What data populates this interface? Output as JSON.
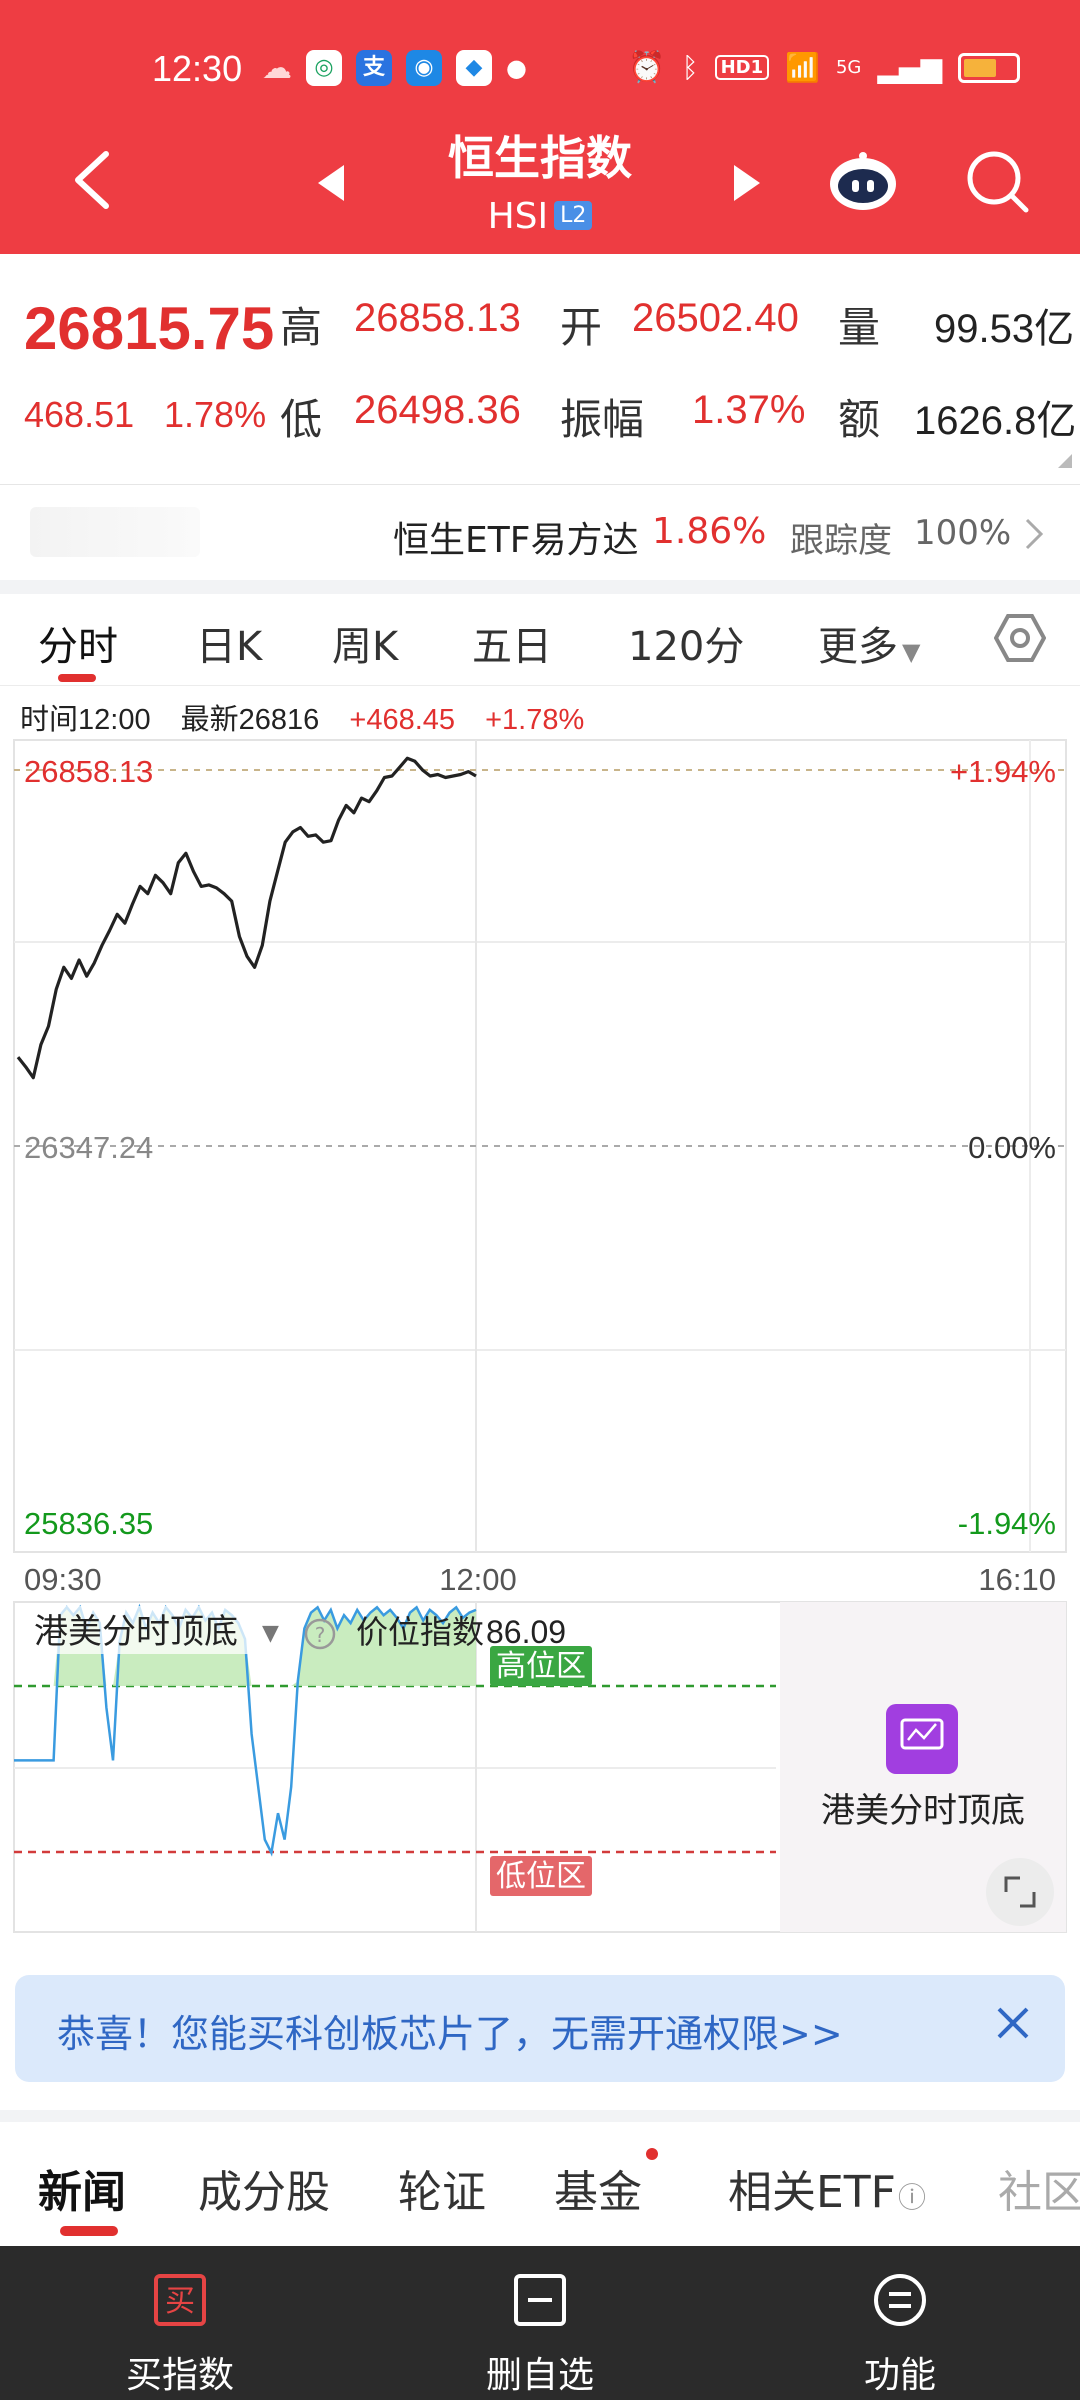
{
  "status_bar": {
    "time": "12:30",
    "net_label": "5G",
    "hd_label": "HD1"
  },
  "header": {
    "title": "恒生指数",
    "code": "HSI",
    "level_badge": "L2"
  },
  "quote": {
    "price": "26815.75",
    "change": "468.51",
    "change_pct": "1.78%",
    "high_label": "高",
    "high": "26858.13",
    "low_label": "低",
    "low": "26498.36",
    "open_label": "开",
    "open": "26502.40",
    "amplitude_label": "振幅",
    "amplitude": "1.37%",
    "volume_label": "量",
    "volume": "99.53亿",
    "turnover_label": "额",
    "turnover": "1626.8亿"
  },
  "etf": {
    "name": "恒生ETF易方达",
    "change": "1.86%",
    "tracking_label": "跟踪度",
    "tracking": "100%"
  },
  "chart_tabs": [
    "分时",
    "日K",
    "周K",
    "五日",
    "120分",
    "更多"
  ],
  "info": {
    "time_label": "时间",
    "time": "12:00",
    "latest_label": "最新",
    "latest": "26816",
    "change": "+468.45",
    "change_pct": "+1.78%"
  },
  "chart_data": {
    "type": "line",
    "x_ticks": [
      "09:30",
      "12:00",
      "16:10"
    ],
    "y_labels": {
      "high": "26858.13",
      "mid": "26347.24",
      "low": "25836.35"
    },
    "pct_labels": {
      "high": "+1.94%",
      "mid": "0.00%",
      "low": "-1.94%"
    },
    "ylim": [
      25836.35,
      26858.13
    ],
    "series": [
      {
        "values": [
          26468,
          26455,
          26440,
          26485,
          26510,
          26560,
          26590,
          26575,
          26600,
          26578,
          26596,
          26620,
          26640,
          26662,
          26650,
          26676,
          26700,
          26690,
          26715,
          26705,
          26690,
          26732,
          26745,
          26720,
          26700,
          26702,
          26698,
          26690,
          26680,
          26632,
          26605,
          26590,
          26620,
          26680,
          26720,
          26760,
          26774,
          26780,
          26768,
          26770,
          26760,
          26762,
          26790,
          26810,
          26800,
          26820,
          26815,
          26830,
          26848,
          26850,
          26862,
          26874,
          26870,
          26858,
          26850,
          26852,
          26848,
          26850,
          26852,
          26856,
          26850
        ]
      }
    ]
  },
  "oscillator": {
    "name": "港美分时顶底",
    "index_label": "价位指数",
    "index_value": "86.09",
    "high_zone": "高位区",
    "low_zone": "低位区",
    "values": [
      40,
      40,
      40,
      40,
      40,
      40,
      40,
      95,
      98,
      95,
      98,
      90,
      96,
      92,
      60,
      40,
      85,
      96,
      92,
      98,
      90,
      96,
      92,
      98,
      95,
      90,
      97,
      94,
      98,
      93,
      96,
      90,
      97,
      95,
      92,
      86,
      50,
      30,
      10,
      5,
      20,
      10,
      30,
      70,
      90,
      96,
      98,
      93,
      97,
      90,
      95,
      92,
      97,
      93,
      96,
      98,
      95,
      97,
      94,
      90,
      96,
      98,
      93,
      97,
      95,
      92,
      96,
      98,
      94,
      96,
      97
    ],
    "side_title": "港美分时顶底"
  },
  "banner": {
    "text": "恭喜！您能买科创板芯片了，无需开通权限>>"
  },
  "news_tabs": [
    "新闻",
    "成分股",
    "轮证",
    "基金",
    "相关ETF",
    "社区"
  ],
  "bottom_nav": [
    "买指数",
    "删自选",
    "功能"
  ],
  "colors": {
    "header": "#ee3d43",
    "up": "#e1302f",
    "down": "#13991c",
    "line": "#222222",
    "osc": "#3a9be0"
  }
}
